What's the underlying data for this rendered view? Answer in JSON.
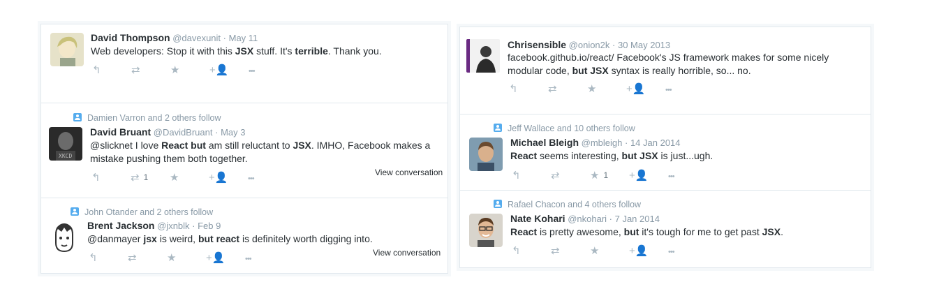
{
  "icons": {
    "reply": "↰",
    "retweet": "⇄",
    "favorite": "★",
    "follow": "+👤",
    "more": "•••"
  },
  "left_panel": {
    "tweets": [
      {
        "fullname": "David Thompson",
        "username": "@davexunit",
        "time": "· May 11",
        "text_parts": [
          "Web developers: Stop it with this ",
          "JSX",
          " stuff.  It's ",
          "terrible",
          ".  Thank you."
        ]
      },
      {
        "context": "Damien Varron and 2 others follow",
        "fullname": "David Bruant",
        "username": "@DavidBruant",
        "time": "· May 3",
        "text_parts": [
          "@slicknet I love ",
          "React but",
          " am still reluctant to ",
          "JSX",
          ". IMHO, Facebook makes a mistake pushing them both together."
        ],
        "retweet_count": "1",
        "view_conversation": "View conversation"
      },
      {
        "context": "John Otander and 2 others follow",
        "fullname": "Brent Jackson",
        "username": "@jxnblk",
        "time": "· Feb 9",
        "text_parts": [
          "@danmayer ",
          "jsx",
          " is weird, ",
          "but react",
          " is definitely worth digging into."
        ],
        "view_conversation": "View conversation"
      }
    ]
  },
  "right_panel": {
    "tweets": [
      {
        "fullname": "Chrisensible",
        "username": "@onion2k",
        "time": "· 30 May 2013",
        "text_parts": [
          "facebook.github.io/react/ Facebook's JS framework makes for some nicely modular code, ",
          "but JSX",
          " syntax is really horrible, so... no."
        ]
      },
      {
        "context": "Jeff Wallace and 10 others follow",
        "fullname": "Michael Bleigh",
        "username": "@mbleigh",
        "time": "· 14 Jan 2014",
        "text_parts": [
          "React",
          " seems interesting, ",
          "but JSX",
          " is just...ugh."
        ],
        "favorite_count": "1"
      },
      {
        "context": "Rafael Chacon and 4 others follow",
        "fullname": "Nate Kohari",
        "username": "@nkohari",
        "time": "· 7 Jan 2014",
        "text_parts": [
          "React",
          " is pretty awesome, ",
          "but",
          " it's tough for me to get past ",
          "JSX",
          "."
        ]
      }
    ]
  }
}
